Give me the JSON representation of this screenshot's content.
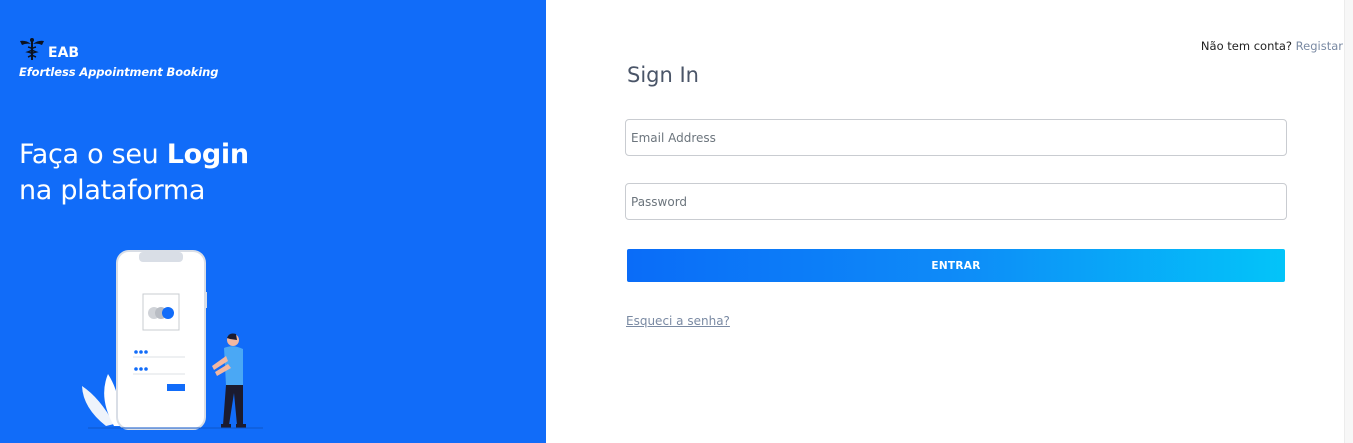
{
  "brand": {
    "name": "EAB",
    "tagline": "Efortless Appointment Booking",
    "logo_icon": "caduceus-icon"
  },
  "hero": {
    "line1_prefix": "Faça o seu ",
    "line1_bold": "Login",
    "line2": "na plataforma"
  },
  "auth_header": {
    "question": "Não tem conta?",
    "register_link": "Registar"
  },
  "form": {
    "title": "Sign In",
    "email_placeholder": "Email Address",
    "email_value": "",
    "password_placeholder": "Password",
    "password_value": "",
    "submit_label": "ENTRAR",
    "forgot_link": "Esqueci a senha?"
  },
  "colors": {
    "left_panel": "#116cf9",
    "button_gradient_start": "#0a6cf8",
    "button_gradient_end": "#03c4f9",
    "link": "#7a8aa3"
  }
}
